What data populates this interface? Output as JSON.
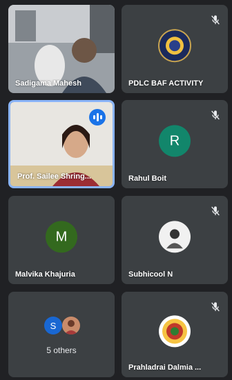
{
  "participants": [
    {
      "name": "Sadigama Mahesh",
      "muted": false,
      "kind": "video"
    },
    {
      "name": "PDLC BAF ACTIVITY",
      "muted": true,
      "kind": "logo"
    },
    {
      "name": "Prof. Sailee Shring...",
      "muted": false,
      "kind": "video",
      "speaking": true
    },
    {
      "name": "Rahul Boit",
      "muted": true,
      "kind": "initial",
      "initial": "R",
      "color": "#12866b"
    },
    {
      "name": "Malvika Khajuria",
      "muted": false,
      "kind": "initial",
      "initial": "M",
      "color": "#33691e"
    },
    {
      "name": "Subhicool N",
      "muted": true,
      "kind": "photo"
    },
    {
      "name": "Prahladrai Dalmia ...",
      "muted": true,
      "kind": "logo2"
    }
  ],
  "others": {
    "label": "5 others",
    "initial": "S",
    "initial_color": "#1967d2"
  }
}
